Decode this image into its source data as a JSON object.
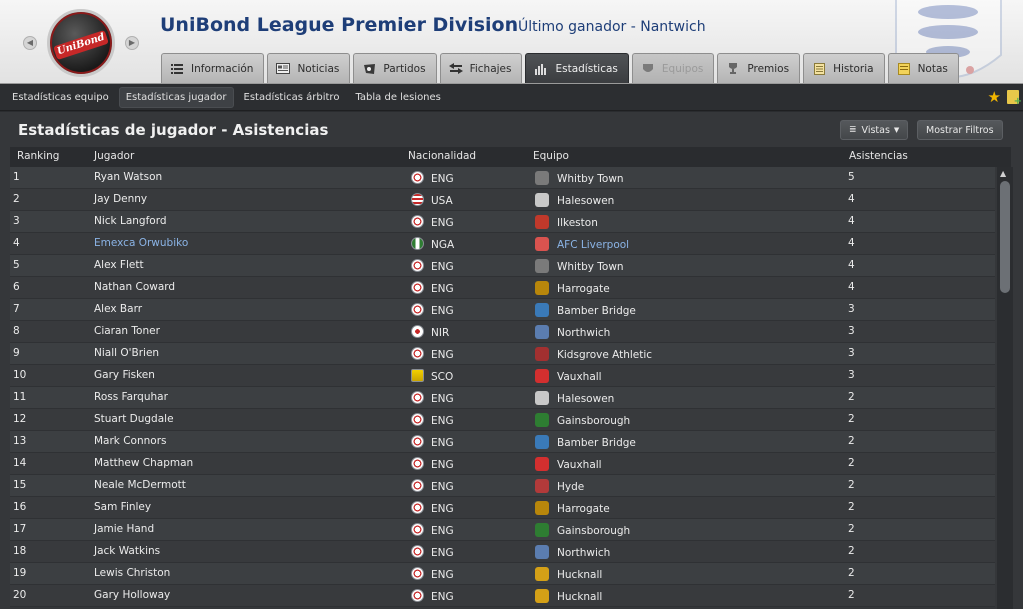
{
  "header": {
    "title": "UniBond League Premier Division",
    "subtitle": "Último ganador - Nantwich",
    "logo_text": "UniBond"
  },
  "tabs": [
    {
      "label": "Información",
      "icon": "list-icon",
      "state": "normal"
    },
    {
      "label": "Noticias",
      "icon": "news-icon",
      "state": "normal"
    },
    {
      "label": "Partidos",
      "icon": "ball-icon",
      "state": "normal"
    },
    {
      "label": "Fichajes",
      "icon": "transfer-icon",
      "state": "normal"
    },
    {
      "label": "Estadísticas",
      "icon": "stats-icon",
      "state": "active"
    },
    {
      "label": "Equipos",
      "icon": "shield-icon",
      "state": "disabled"
    },
    {
      "label": "Premios",
      "icon": "trophy-icon",
      "state": "normal"
    },
    {
      "label": "Historia",
      "icon": "book-icon",
      "state": "normal"
    },
    {
      "label": "Notas",
      "icon": "note-icon",
      "state": "normal"
    }
  ],
  "subtabs": [
    {
      "label": "Estadísticas equipo",
      "active": false
    },
    {
      "label": "Estadísticas jugador",
      "active": true
    },
    {
      "label": "Estadísticas árbitro",
      "active": false
    },
    {
      "label": "Tabla de lesiones",
      "active": false
    }
  ],
  "panel": {
    "title": "Estadísticas de jugador - Asistencias",
    "views_label": "Vistas",
    "filters_label": "Mostrar Filtros"
  },
  "columns": {
    "ranking": "Ranking",
    "player": "Jugador",
    "nationality": "Nacionalidad",
    "club": "Equipo",
    "assists": "Asistencias"
  },
  "colors": {
    "accent_title": "#1e3e78",
    "link": "#8bb4e6",
    "active_tab": "#45484b"
  },
  "rows": [
    {
      "rank": "1",
      "player": "Ryan Watson",
      "nat": "ENG",
      "club": "Whitby Town",
      "assists": "5",
      "linked": false,
      "club_color": "#7a7a7a"
    },
    {
      "rank": "2",
      "player": "Jay Denny",
      "nat": "USA",
      "club": "Halesowen",
      "assists": "4",
      "linked": false,
      "club_color": "#c8c8c8"
    },
    {
      "rank": "3",
      "player": "Nick Langford",
      "nat": "ENG",
      "club": "Ilkeston",
      "assists": "4",
      "linked": false,
      "club_color": "#c0392b"
    },
    {
      "rank": "4",
      "player": "Emexca Orwubiko",
      "nat": "NGA",
      "club": "AFC Liverpool",
      "assists": "4",
      "linked": true,
      "club_color": "#d9534f"
    },
    {
      "rank": "5",
      "player": "Alex Flett",
      "nat": "ENG",
      "club": "Whitby Town",
      "assists": "4",
      "linked": false,
      "club_color": "#7a7a7a"
    },
    {
      "rank": "6",
      "player": "Nathan Coward",
      "nat": "ENG",
      "club": "Harrogate",
      "assists": "4",
      "linked": false,
      "club_color": "#b8860b"
    },
    {
      "rank": "7",
      "player": "Alex Barr",
      "nat": "ENG",
      "club": "Bamber Bridge",
      "assists": "3",
      "linked": false,
      "club_color": "#3a7ab8"
    },
    {
      "rank": "8",
      "player": "Ciaran Toner",
      "nat": "NIR",
      "club": "Northwich",
      "assists": "3",
      "linked": false,
      "club_color": "#5b7db0"
    },
    {
      "rank": "9",
      "player": "Niall O'Brien",
      "nat": "ENG",
      "club": "Kidsgrove Athletic",
      "assists": "3",
      "linked": false,
      "club_color": "#a23030"
    },
    {
      "rank": "10",
      "player": "Gary Fisken",
      "nat": "SCO",
      "club": "Vauxhall",
      "assists": "3",
      "linked": false,
      "club_color": "#d32f2f"
    },
    {
      "rank": "11",
      "player": "Ross Farquhar",
      "nat": "ENG",
      "club": "Halesowen",
      "assists": "2",
      "linked": false,
      "club_color": "#c8c8c8"
    },
    {
      "rank": "12",
      "player": "Stuart Dugdale",
      "nat": "ENG",
      "club": "Gainsborough",
      "assists": "2",
      "linked": false,
      "club_color": "#2e7d32"
    },
    {
      "rank": "13",
      "player": "Mark Connors",
      "nat": "ENG",
      "club": "Bamber Bridge",
      "assists": "2",
      "linked": false,
      "club_color": "#3a7ab8"
    },
    {
      "rank": "14",
      "player": "Matthew Chapman",
      "nat": "ENG",
      "club": "Vauxhall",
      "assists": "2",
      "linked": false,
      "club_color": "#d32f2f"
    },
    {
      "rank": "15",
      "player": "Neale McDermott",
      "nat": "ENG",
      "club": "Hyde",
      "assists": "2",
      "linked": false,
      "club_color": "#b23a3a"
    },
    {
      "rank": "16",
      "player": "Sam Finley",
      "nat": "ENG",
      "club": "Harrogate",
      "assists": "2",
      "linked": false,
      "club_color": "#b8860b"
    },
    {
      "rank": "17",
      "player": "Jamie Hand",
      "nat": "ENG",
      "club": "Gainsborough",
      "assists": "2",
      "linked": false,
      "club_color": "#2e7d32"
    },
    {
      "rank": "18",
      "player": "Jack Watkins",
      "nat": "ENG",
      "club": "Northwich",
      "assists": "2",
      "linked": false,
      "club_color": "#5b7db0"
    },
    {
      "rank": "19",
      "player": "Lewis Christon",
      "nat": "ENG",
      "club": "Hucknall",
      "assists": "2",
      "linked": false,
      "club_color": "#d4a017"
    },
    {
      "rank": "20",
      "player": "Gary Holloway",
      "nat": "ENG",
      "club": "Hucknall",
      "assists": "2",
      "linked": false,
      "club_color": "#d4a017"
    }
  ]
}
